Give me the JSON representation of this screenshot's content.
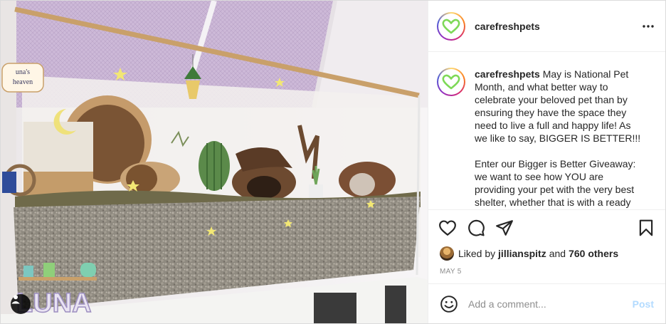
{
  "post": {
    "username": "carefreshpets",
    "caption": {
      "username": "carefreshpets",
      "text": " May is National Pet Month, and what better way to celebrate your beloved pet than by ensuring they have the space they need to live a full and happy life! As we like to say, BIGGER IS BETTER!!!\n\nEnter our Bigger is Better Giveaway: we want to see how YOU are providing your pet with the very best shelter, whether that is with a ready"
    },
    "likes": {
      "prefix": "Liked by",
      "first_user": "jillianspitz",
      "mid": "and",
      "others": "760 others"
    },
    "date": "MAY 5"
  },
  "photo": {
    "sign_text": "una's heaven",
    "name_text": "LUNA"
  },
  "comment": {
    "placeholder": "Add a comment...",
    "post_label": "Post"
  },
  "icons": {
    "more": "more-options-icon",
    "like": "heart-icon",
    "comment": "comment-icon",
    "share": "paper-plane-icon",
    "save": "bookmark-icon",
    "emoji": "emoji-icon",
    "user_tag": "user-tag-icon"
  },
  "colors": {
    "brand_heart": "#7ed957",
    "post_disabled": "#b3dbff",
    "muted": "#8e8e8e"
  }
}
